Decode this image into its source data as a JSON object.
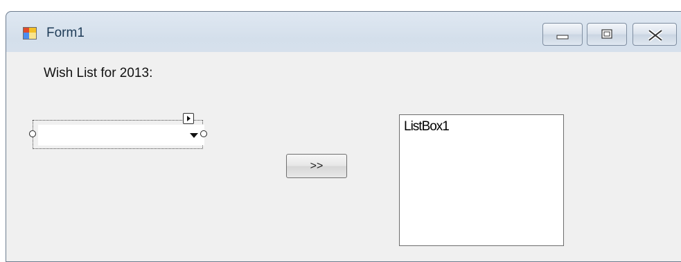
{
  "window": {
    "title": "Form1"
  },
  "form": {
    "wish_label": "Wish List for 2013:",
    "combo_value": "",
    "button_label": ">>",
    "listbox_label": "ListBox1"
  }
}
